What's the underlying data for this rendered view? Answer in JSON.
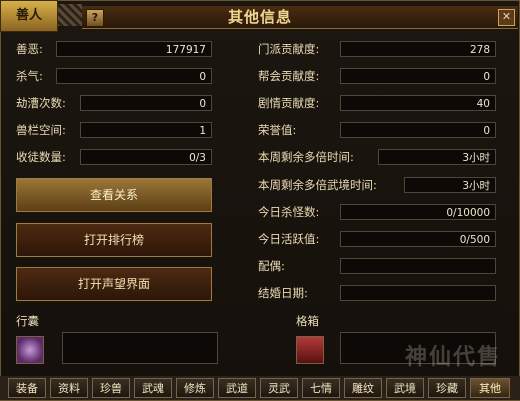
{
  "window": {
    "title": "其他信息",
    "corner_tag": "善人",
    "help_label": "?",
    "close_label": "✕"
  },
  "left_stats": [
    {
      "label": "善恶:",
      "value": "177917"
    },
    {
      "label": "杀气:",
      "value": "0"
    },
    {
      "label": "劫漕次数:",
      "value": "0"
    },
    {
      "label": "兽栏空间:",
      "value": "1"
    },
    {
      "label": "收徒数量:",
      "value": "0/3"
    }
  ],
  "right_stats": [
    {
      "label": "门派贡献度:",
      "value": "278"
    },
    {
      "label": "帮会贡献度:",
      "value": "0"
    },
    {
      "label": "剧情贡献度:",
      "value": "40"
    },
    {
      "label": "荣誉值:",
      "value": "0"
    },
    {
      "label": "本周剩余多倍时间:",
      "value": "3小时"
    },
    {
      "label": "本周剩余多倍武境时间:",
      "value": "3小时"
    },
    {
      "label": "今日杀怪数:",
      "value": "0/10000"
    },
    {
      "label": "今日活跃值:",
      "value": "0/500"
    },
    {
      "label": "配偶:",
      "value": ""
    },
    {
      "label": "结婚日期:",
      "value": ""
    }
  ],
  "buttons": {
    "view_relations": "查看关系",
    "open_ranking": "打开排行榜",
    "open_reputation": "打开声望界面"
  },
  "slots": {
    "bag_label": "行囊",
    "box_label": "格箱"
  },
  "tabs": [
    "装备",
    "资料",
    "珍兽",
    "武魂",
    "修炼",
    "武道",
    "灵武",
    "七情",
    "雕纹",
    "武境",
    "珍藏",
    "其他"
  ],
  "active_tab": "其他",
  "watermark": "神仙代售",
  "colors": {
    "text": "#ecd9a8",
    "button_primary": "#9a7638",
    "button": "#4e2a12",
    "border": "#a07a40"
  }
}
